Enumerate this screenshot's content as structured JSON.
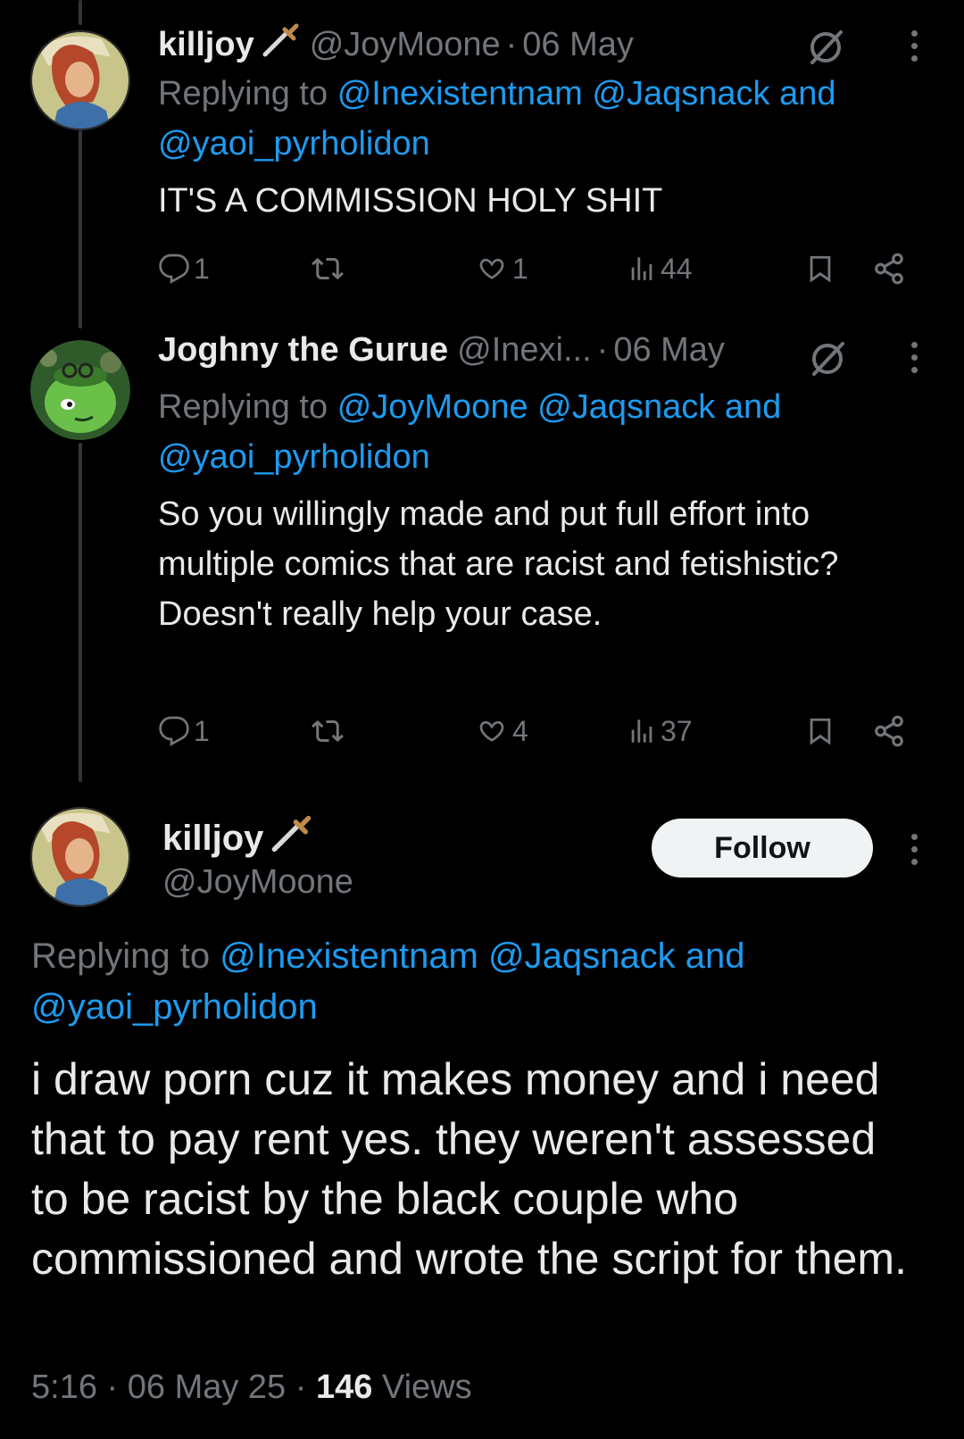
{
  "post1": {
    "name": "killjoy",
    "handle": "@JoyMoone",
    "date": "06 May",
    "replying_prefix": "Replying to",
    "mention1": "@Inexistentnam",
    "mention2": "@Jaqsnack",
    "and_word": "and",
    "mention3": "@yaoi_pyrholidon",
    "text": "IT'S A COMMISSION HOLY SHIT",
    "replies": "1",
    "reposts": "",
    "likes": "1",
    "views": "44"
  },
  "post2": {
    "name": "Joghny the Gurue",
    "handle": "@Inexi...",
    "date": "06 May",
    "replying_prefix": "Replying to",
    "mention1": "@JoyMoone",
    "mention2": "@Jaqsnack",
    "and_word": "and",
    "mention3": "@yaoi_pyrholidon",
    "text": "So you willingly made and put full effort into multiple comics that are racist and fetishistic?\nDoesn't really help your case.",
    "replies": "1",
    "reposts": "",
    "likes": "4",
    "views": "37"
  },
  "main": {
    "name": "killjoy",
    "handle": "@JoyMoone",
    "follow_label": "Follow",
    "replying_prefix": "Replying to",
    "mention1": "@Inexistentnam",
    "mention2": "@Jaqsnack",
    "and_word": "and",
    "mention3": "@yaoi_pyrholidon",
    "text": "i draw porn cuz it makes money and i need that to pay rent yes. they weren't assessed to be racist by the black couple who commissioned and wrote the script for them.",
    "time": "5:16",
    "date": "06 May 25",
    "views_count": "146",
    "views_label": "Views"
  },
  "icons": {
    "verified_hidden": "circle-slash-icon",
    "emoji": "dagger-icon",
    "reply": "reply-icon",
    "repost": "repost-icon",
    "like": "heart-icon",
    "views": "views-icon",
    "bookmark": "bookmark-icon",
    "share": "share-icon",
    "more": "more-icon"
  },
  "colors": {
    "background": "#000000",
    "text": "#e7e9ea",
    "muted": "#71767b",
    "link": "#1d9bf0",
    "follow_bg": "#eff3f4"
  }
}
